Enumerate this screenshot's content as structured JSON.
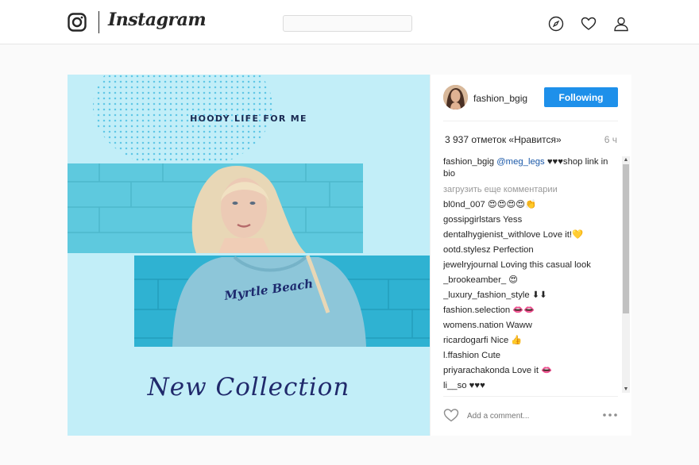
{
  "header": {
    "wordmark": "Instagram",
    "search_value": ""
  },
  "post": {
    "image_headline": "HOODY LIFE FOR ME",
    "image_collection": "New Collection",
    "image_shirt_text": "Myrtle Beach",
    "author": "fashion_bgig",
    "follow_label": "Following",
    "likes_text": "3 937 отметок «Нравится»",
    "time_text": "6 ч",
    "caption": {
      "user": "fashion_bgig",
      "mention": "@meg_legs",
      "text": "♥♥♥shop link in bio"
    },
    "load_more": "загрузить еще комментарии",
    "comments": [
      {
        "user": "bl0nd_007",
        "text": "😍😍😍😍👏"
      },
      {
        "user": "gossipgirlstars",
        "text": "Yess"
      },
      {
        "user": "dentalhygienist_withlove",
        "text": "Love it!💛"
      },
      {
        "user": "ootd.stylesz",
        "text": "Perfection"
      },
      {
        "user": "jewelryjournal",
        "text": "Loving this casual look"
      },
      {
        "user": "_brookeamber_",
        "text": "😍"
      },
      {
        "user": "_luxury_fashion_style",
        "text": "⬇⬇"
      },
      {
        "user": "fashion.selection",
        "text": "👄👄"
      },
      {
        "user": "womens.nation",
        "text": "Waww"
      },
      {
        "user": "ricardogarfi",
        "text": "Nice 👍"
      },
      {
        "user": "l.ffashion",
        "text": "Cute"
      },
      {
        "user": "priyarachakonda",
        "text": "Love it 👄"
      },
      {
        "user": "li__so",
        "text": "♥♥♥"
      }
    ],
    "comment_placeholder": "Add a comment..."
  },
  "colors": {
    "accent": "#1e90ea",
    "image_bg": "#c2eef8",
    "collection_text": "#20296b"
  }
}
